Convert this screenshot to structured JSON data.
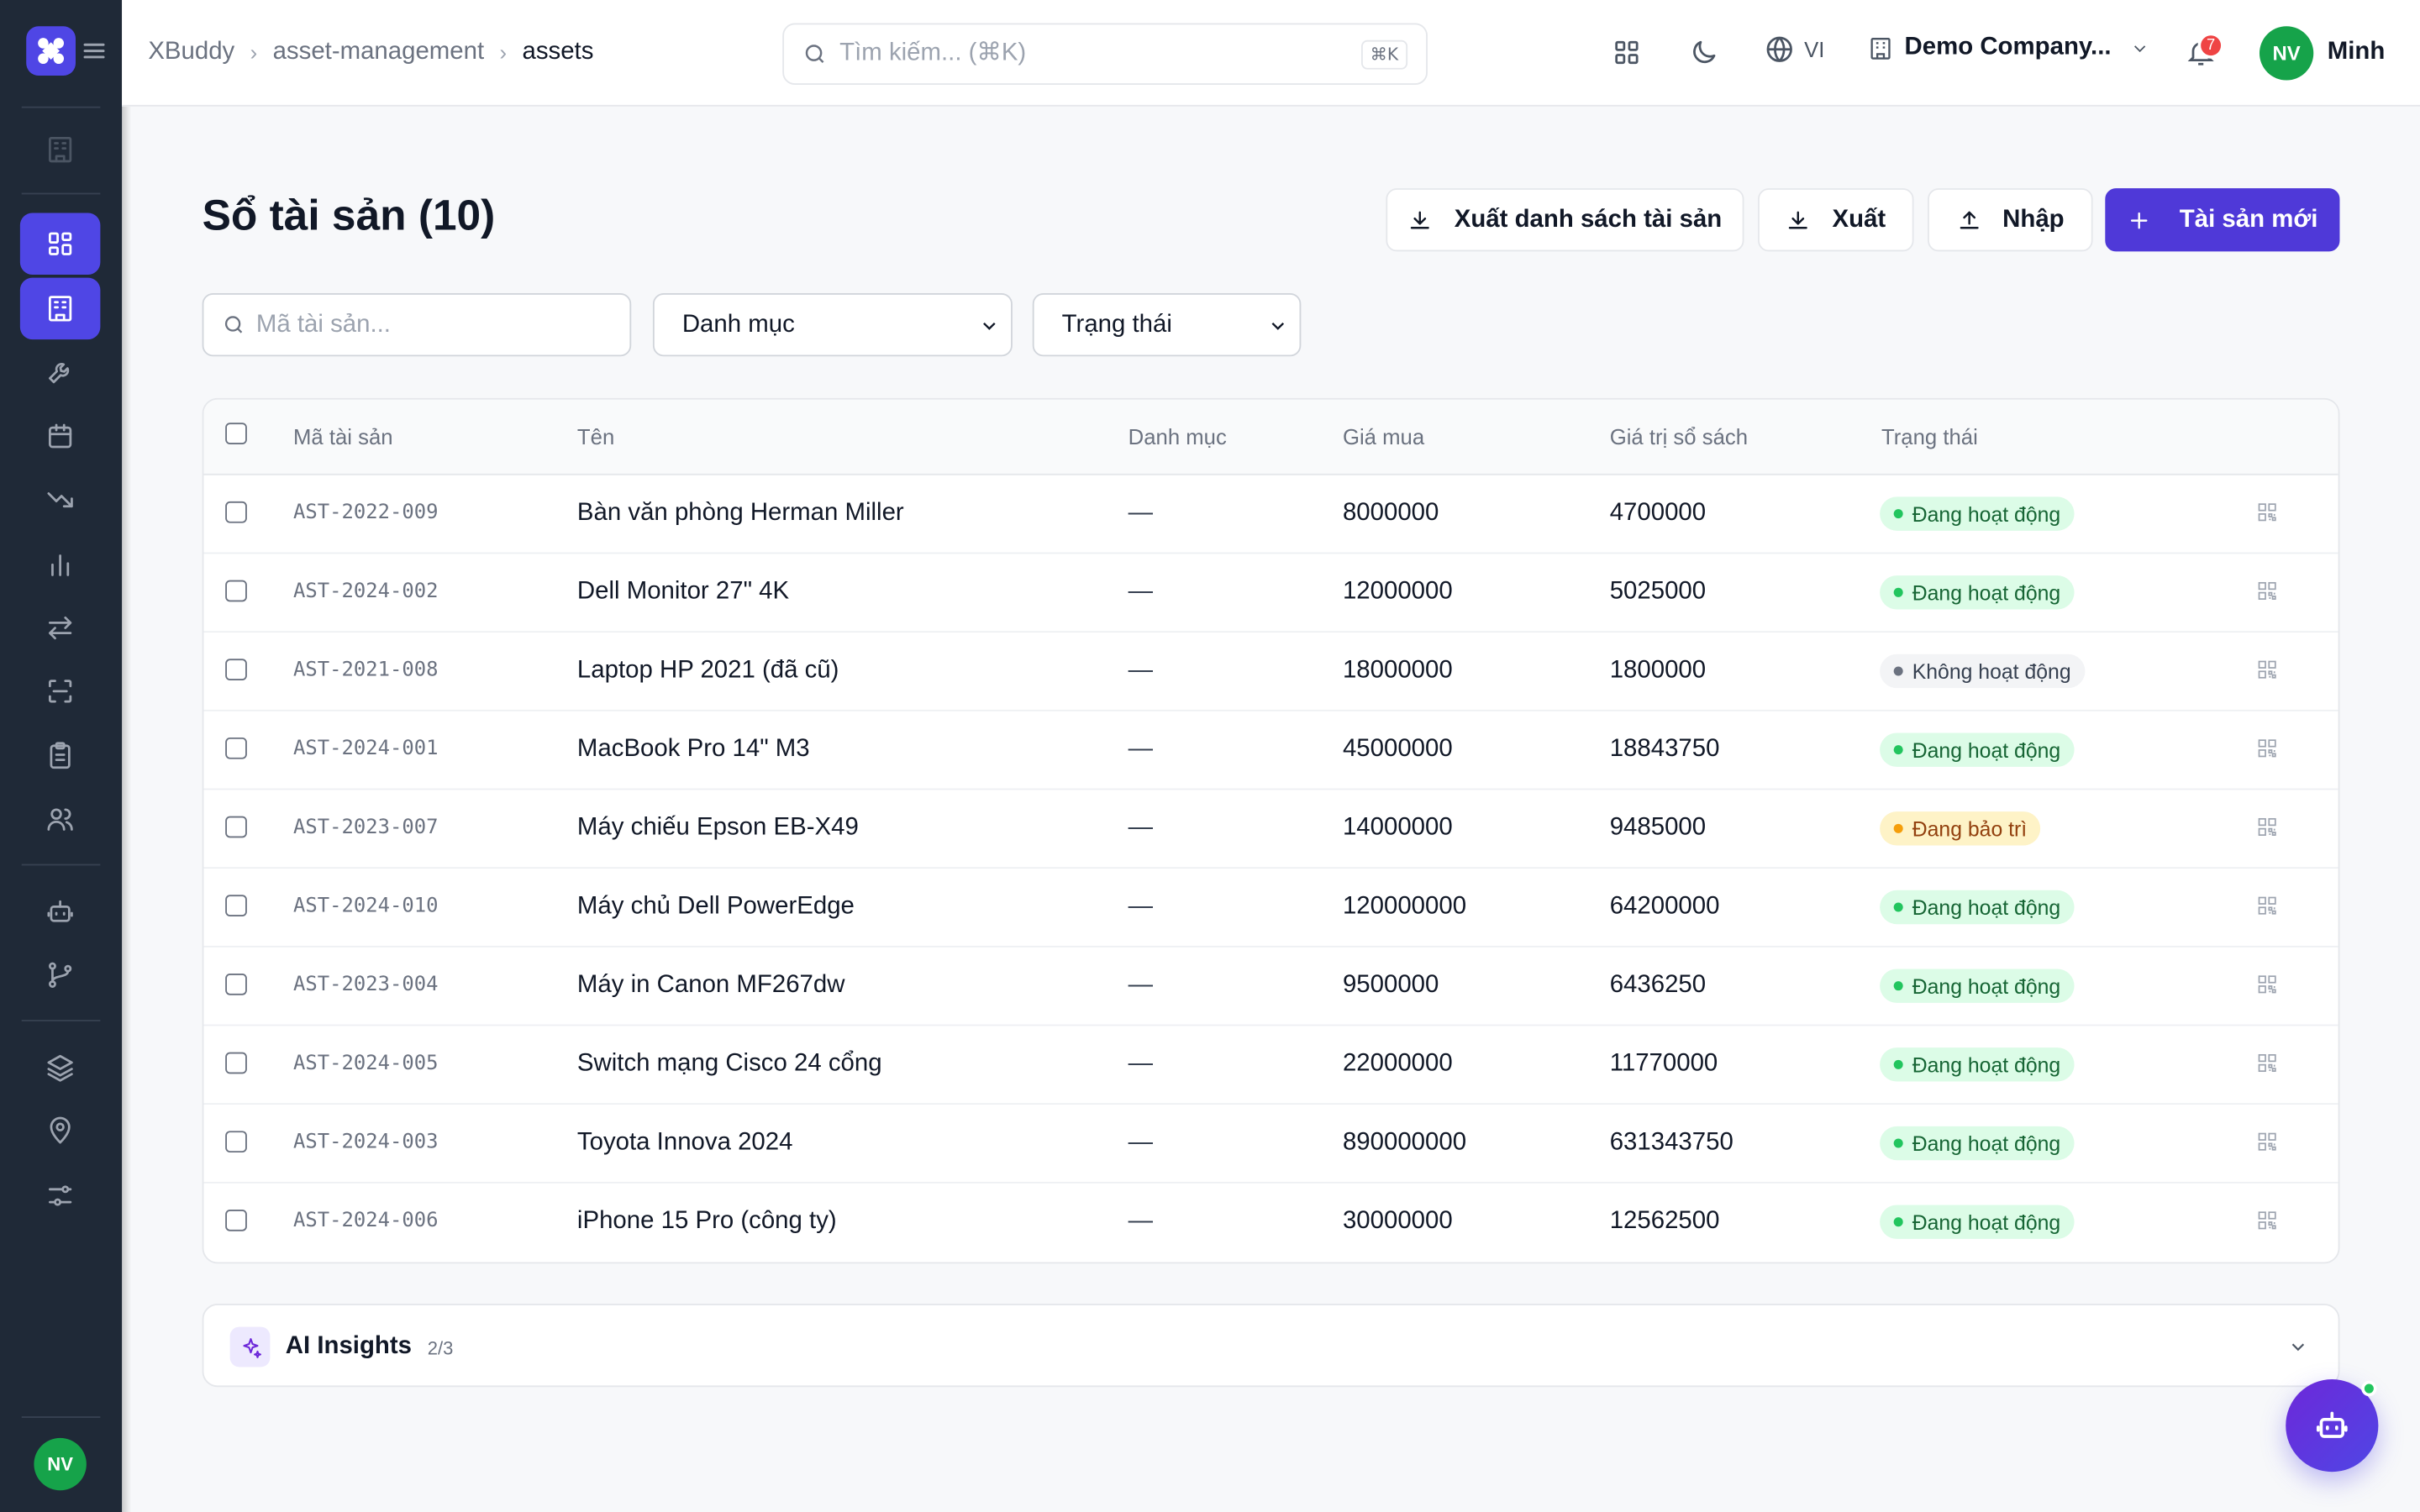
{
  "app": {
    "name": "XBuddy"
  },
  "breadcrumb": [
    "XBuddy",
    "asset-management",
    "assets"
  ],
  "topbar": {
    "search_placeholder": "Tìm kiếm... (⌘K)",
    "search_shortcut": "⌘K",
    "language": "VI",
    "company": "Demo Company...",
    "notifications_count": "7",
    "user_initials": "NV",
    "user_name": "Minh"
  },
  "sidebar": {
    "items": [
      {
        "icon": "building-icon",
        "state": "muted"
      },
      {
        "icon": "dashboard-icon",
        "state": "active"
      },
      {
        "icon": "building-icon",
        "state": "active"
      },
      {
        "icon": "wrench-icon"
      },
      {
        "icon": "calendar-icon"
      },
      {
        "icon": "trending-down-icon"
      },
      {
        "icon": "bar-chart-icon"
      },
      {
        "icon": "transfer-icon"
      },
      {
        "icon": "scan-icon"
      },
      {
        "icon": "clipboard-icon"
      },
      {
        "icon": "users-icon"
      },
      {
        "icon": "bot-icon"
      },
      {
        "icon": "git-branch-icon"
      },
      {
        "icon": "layers-icon"
      },
      {
        "icon": "map-pin-icon"
      },
      {
        "icon": "sliders-icon"
      }
    ],
    "user_initials": "NV"
  },
  "page": {
    "title": "Sổ tài sản (10)",
    "buttons": {
      "export_list": "Xuất danh sách tài sản",
      "export": "Xuất",
      "import": "Nhập",
      "new_asset": "Tài sản mới"
    },
    "filters": {
      "code_placeholder": "Mã tài sản...",
      "category": "Danh mục",
      "status": "Trạng thái"
    }
  },
  "table": {
    "columns": [
      "Mã tài sản",
      "Tên",
      "Danh mục",
      "Giá mua",
      "Giá trị sổ sách",
      "Trạng thái"
    ],
    "rows": [
      {
        "code": "AST-2022-009",
        "name": "Bàn văn phòng Herman Miller",
        "category": "—",
        "price": "8000000",
        "book": "4700000",
        "status": "Đang hoạt động",
        "kind": "active"
      },
      {
        "code": "AST-2024-002",
        "name": "Dell Monitor 27\" 4K",
        "category": "—",
        "price": "12000000",
        "book": "5025000",
        "status": "Đang hoạt động",
        "kind": "active"
      },
      {
        "code": "AST-2021-008",
        "name": "Laptop HP 2021 (đã cũ)",
        "category": "—",
        "price": "18000000",
        "book": "1800000",
        "status": "Không hoạt động",
        "kind": "inactive"
      },
      {
        "code": "AST-2024-001",
        "name": "MacBook Pro 14\" M3",
        "category": "—",
        "price": "45000000",
        "book": "18843750",
        "status": "Đang hoạt động",
        "kind": "active"
      },
      {
        "code": "AST-2023-007",
        "name": "Máy chiếu Epson EB-X49",
        "category": "—",
        "price": "14000000",
        "book": "9485000",
        "status": "Đang bảo trì",
        "kind": "maint"
      },
      {
        "code": "AST-2024-010",
        "name": "Máy chủ Dell PowerEdge",
        "category": "—",
        "price": "120000000",
        "book": "64200000",
        "status": "Đang hoạt động",
        "kind": "active"
      },
      {
        "code": "AST-2023-004",
        "name": "Máy in Canon MF267dw",
        "category": "—",
        "price": "9500000",
        "book": "6436250",
        "status": "Đang hoạt động",
        "kind": "active"
      },
      {
        "code": "AST-2024-005",
        "name": "Switch mạng Cisco 24 cổng",
        "category": "—",
        "price": "22000000",
        "book": "11770000",
        "status": "Đang hoạt động",
        "kind": "active"
      },
      {
        "code": "AST-2024-003",
        "name": "Toyota Innova 2024",
        "category": "—",
        "price": "890000000",
        "book": "631343750",
        "status": "Đang hoạt động",
        "kind": "active"
      },
      {
        "code": "AST-2024-006",
        "name": "iPhone 15 Pro (công ty)",
        "category": "—",
        "price": "30000000",
        "book": "12562500",
        "status": "Đang hoạt động",
        "kind": "active"
      }
    ]
  },
  "ai_insights": {
    "title": "AI Insights",
    "count": "2/3"
  },
  "colors": {
    "primary": "#4f39d8",
    "sidebar_bg": "#1f2937",
    "active_green": "#22c55e",
    "maint_amber": "#f59e0b"
  }
}
